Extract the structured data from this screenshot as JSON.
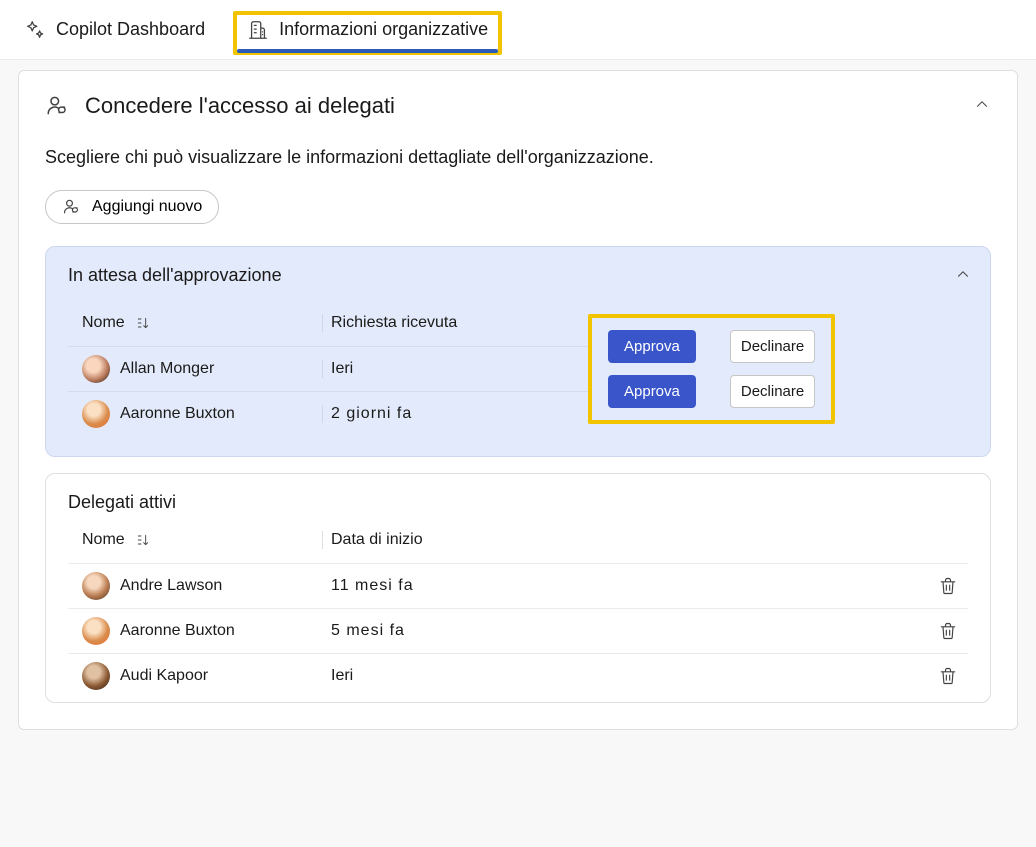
{
  "tabs": {
    "dashboard": "Copilot Dashboard",
    "org_info": "Informazioni organizzative"
  },
  "section": {
    "title": "Concedere l'accesso ai delegati",
    "description": "Scegliere chi può visualizzare le informazioni dettagliate dell'organizzazione.",
    "add_new": "Aggiungi nuovo"
  },
  "pending": {
    "title": "In attesa dell'approvazione",
    "col_name": "Nome",
    "col_request": "Richiesta ricevuta",
    "approve_label": "Approva",
    "decline_label": "Declinare",
    "rows": [
      {
        "name": "Allan Monger",
        "when": "Ieri"
      },
      {
        "name": "Aaronne  Buxton",
        "when": "2 giorni fa"
      }
    ]
  },
  "active": {
    "title": "Delegati attivi",
    "col_name": "Nome",
    "col_start": "Data di inizio",
    "rows": [
      {
        "name": "Andre Lawson",
        "when": "11 mesi fa"
      },
      {
        "name": "Aaronne  Buxton",
        "when": "5 mesi fa"
      },
      {
        "name": "Audi Kapoor",
        "when": "Ieri"
      }
    ]
  }
}
